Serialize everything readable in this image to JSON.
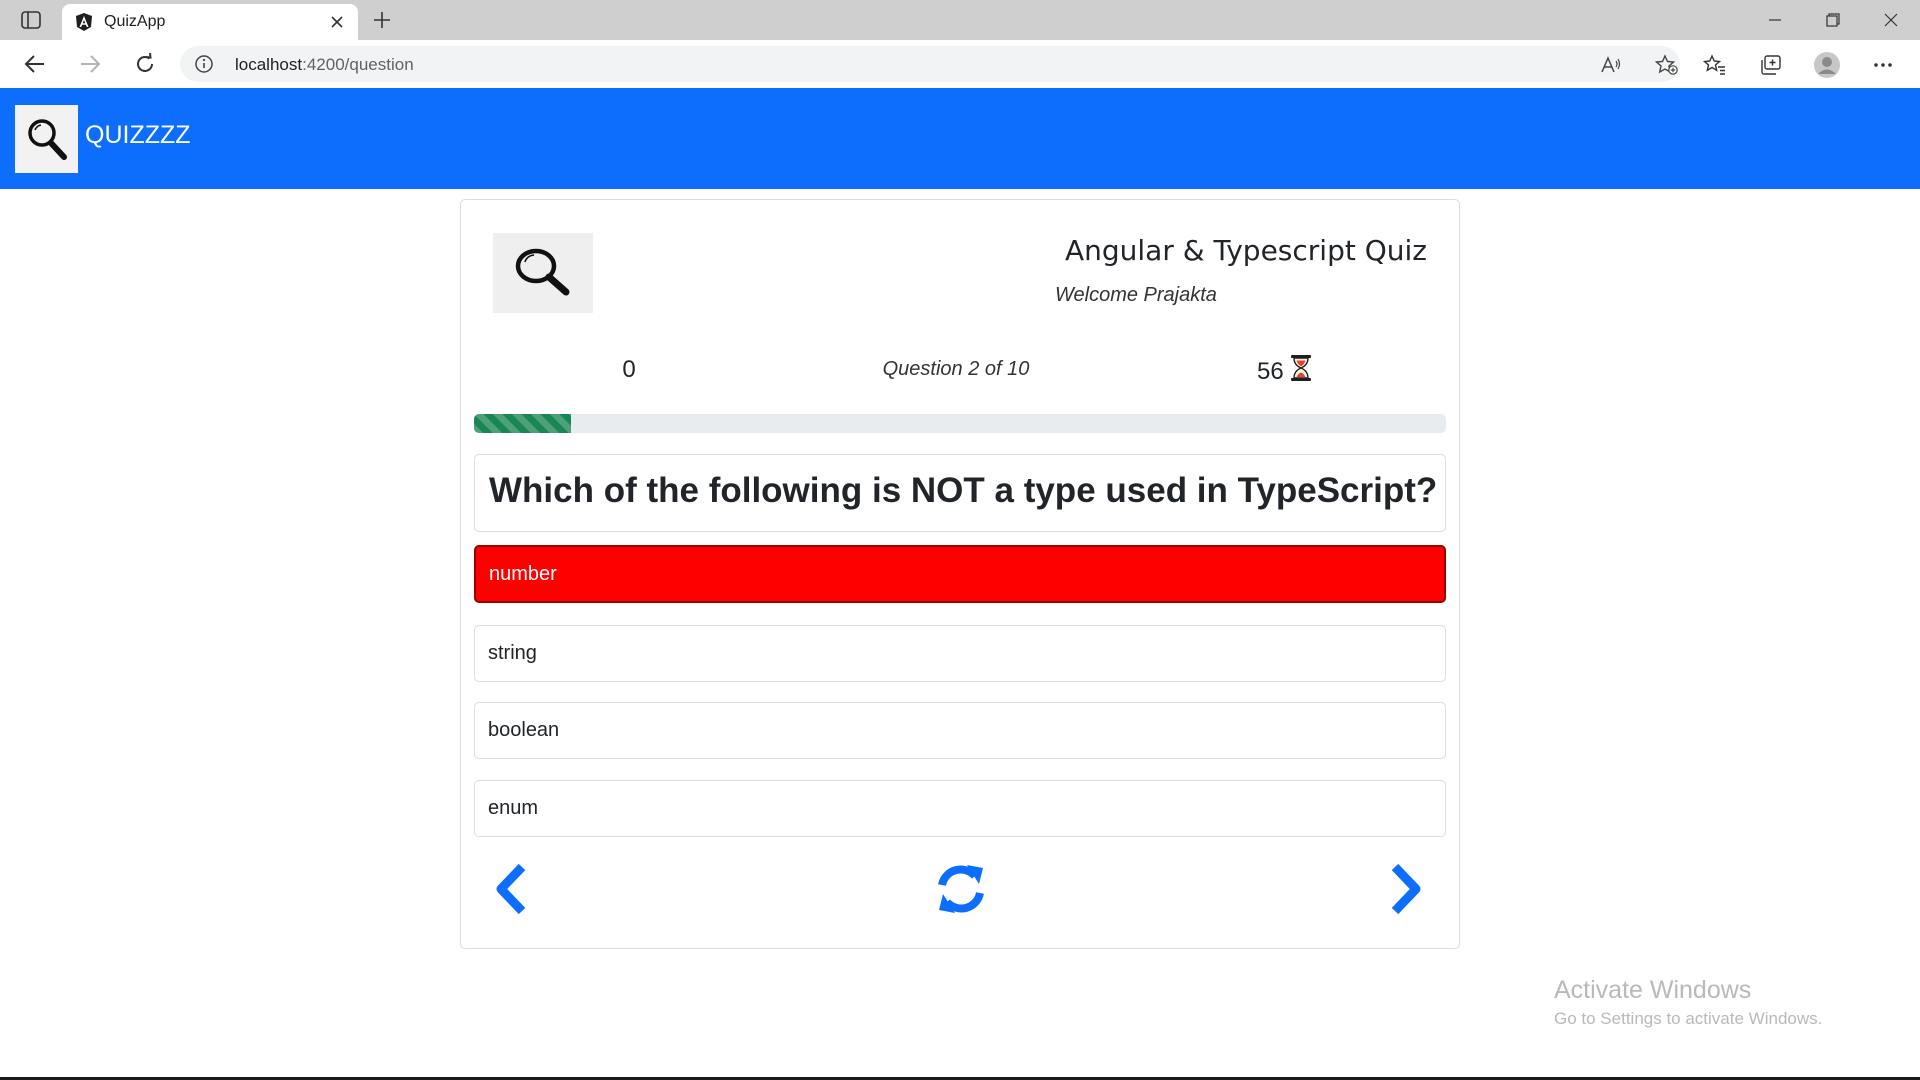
{
  "browser": {
    "tab_title": "QuizApp",
    "url_host": "localhost",
    "url_rest": ":4200/question"
  },
  "app": {
    "brand": "QUIZZZZ"
  },
  "quiz": {
    "title": "Angular & Typescript Quiz",
    "welcome": "Welcome Prajakta",
    "points": "0",
    "question_counter": "Question 2 of 10",
    "timer": "56",
    "progress_fraction": 0.1,
    "question": "Which of the following is NOT a type used in TypeScript?",
    "options": [
      {
        "label": "number",
        "selected": true
      },
      {
        "label": "string",
        "selected": false
      },
      {
        "label": "boolean",
        "selected": false
      },
      {
        "label": "enum",
        "selected": false
      }
    ]
  },
  "colors": {
    "navbar": "#0d6efd",
    "selected_option": "#ff0000",
    "progress": "#198754",
    "nav_icons": "#0d6efd"
  },
  "watermark": {
    "line1": "Activate Windows",
    "line2": "Go to Settings to activate Windows."
  }
}
